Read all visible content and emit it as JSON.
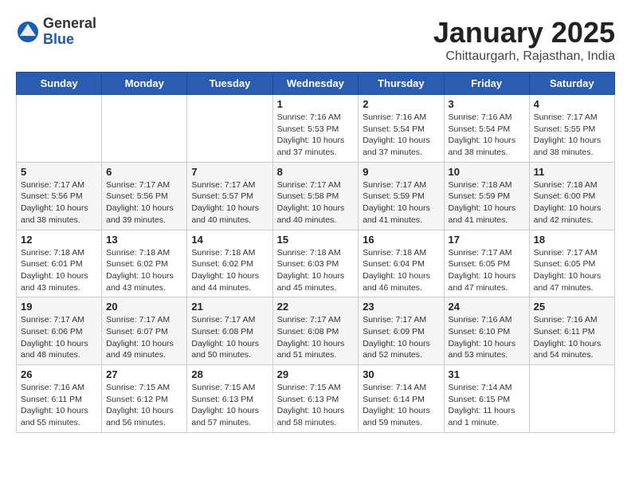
{
  "header": {
    "logo_general": "General",
    "logo_blue": "Blue",
    "month_title": "January 2025",
    "subtitle": "Chittaurgarh, Rajasthan, India"
  },
  "calendar": {
    "weekdays": [
      "Sunday",
      "Monday",
      "Tuesday",
      "Wednesday",
      "Thursday",
      "Friday",
      "Saturday"
    ],
    "weeks": [
      [
        {
          "day": "",
          "info": ""
        },
        {
          "day": "",
          "info": ""
        },
        {
          "day": "",
          "info": ""
        },
        {
          "day": "1",
          "info": "Sunrise: 7:16 AM\nSunset: 5:53 PM\nDaylight: 10 hours\nand 37 minutes."
        },
        {
          "day": "2",
          "info": "Sunrise: 7:16 AM\nSunset: 5:54 PM\nDaylight: 10 hours\nand 37 minutes."
        },
        {
          "day": "3",
          "info": "Sunrise: 7:16 AM\nSunset: 5:54 PM\nDaylight: 10 hours\nand 38 minutes."
        },
        {
          "day": "4",
          "info": "Sunrise: 7:17 AM\nSunset: 5:55 PM\nDaylight: 10 hours\nand 38 minutes."
        }
      ],
      [
        {
          "day": "5",
          "info": "Sunrise: 7:17 AM\nSunset: 5:56 PM\nDaylight: 10 hours\nand 38 minutes."
        },
        {
          "day": "6",
          "info": "Sunrise: 7:17 AM\nSunset: 5:56 PM\nDaylight: 10 hours\nand 39 minutes."
        },
        {
          "day": "7",
          "info": "Sunrise: 7:17 AM\nSunset: 5:57 PM\nDaylight: 10 hours\nand 40 minutes."
        },
        {
          "day": "8",
          "info": "Sunrise: 7:17 AM\nSunset: 5:58 PM\nDaylight: 10 hours\nand 40 minutes."
        },
        {
          "day": "9",
          "info": "Sunrise: 7:17 AM\nSunset: 5:59 PM\nDaylight: 10 hours\nand 41 minutes."
        },
        {
          "day": "10",
          "info": "Sunrise: 7:18 AM\nSunset: 5:59 PM\nDaylight: 10 hours\nand 41 minutes."
        },
        {
          "day": "11",
          "info": "Sunrise: 7:18 AM\nSunset: 6:00 PM\nDaylight: 10 hours\nand 42 minutes."
        }
      ],
      [
        {
          "day": "12",
          "info": "Sunrise: 7:18 AM\nSunset: 6:01 PM\nDaylight: 10 hours\nand 43 minutes."
        },
        {
          "day": "13",
          "info": "Sunrise: 7:18 AM\nSunset: 6:02 PM\nDaylight: 10 hours\nand 43 minutes."
        },
        {
          "day": "14",
          "info": "Sunrise: 7:18 AM\nSunset: 6:02 PM\nDaylight: 10 hours\nand 44 minutes."
        },
        {
          "day": "15",
          "info": "Sunrise: 7:18 AM\nSunset: 6:03 PM\nDaylight: 10 hours\nand 45 minutes."
        },
        {
          "day": "16",
          "info": "Sunrise: 7:18 AM\nSunset: 6:04 PM\nDaylight: 10 hours\nand 46 minutes."
        },
        {
          "day": "17",
          "info": "Sunrise: 7:17 AM\nSunset: 6:05 PM\nDaylight: 10 hours\nand 47 minutes."
        },
        {
          "day": "18",
          "info": "Sunrise: 7:17 AM\nSunset: 6:05 PM\nDaylight: 10 hours\nand 47 minutes."
        }
      ],
      [
        {
          "day": "19",
          "info": "Sunrise: 7:17 AM\nSunset: 6:06 PM\nDaylight: 10 hours\nand 48 minutes."
        },
        {
          "day": "20",
          "info": "Sunrise: 7:17 AM\nSunset: 6:07 PM\nDaylight: 10 hours\nand 49 minutes."
        },
        {
          "day": "21",
          "info": "Sunrise: 7:17 AM\nSunset: 6:08 PM\nDaylight: 10 hours\nand 50 minutes."
        },
        {
          "day": "22",
          "info": "Sunrise: 7:17 AM\nSunset: 6:08 PM\nDaylight: 10 hours\nand 51 minutes."
        },
        {
          "day": "23",
          "info": "Sunrise: 7:17 AM\nSunset: 6:09 PM\nDaylight: 10 hours\nand 52 minutes."
        },
        {
          "day": "24",
          "info": "Sunrise: 7:16 AM\nSunset: 6:10 PM\nDaylight: 10 hours\nand 53 minutes."
        },
        {
          "day": "25",
          "info": "Sunrise: 7:16 AM\nSunset: 6:11 PM\nDaylight: 10 hours\nand 54 minutes."
        }
      ],
      [
        {
          "day": "26",
          "info": "Sunrise: 7:16 AM\nSunset: 6:11 PM\nDaylight: 10 hours\nand 55 minutes."
        },
        {
          "day": "27",
          "info": "Sunrise: 7:15 AM\nSunset: 6:12 PM\nDaylight: 10 hours\nand 56 minutes."
        },
        {
          "day": "28",
          "info": "Sunrise: 7:15 AM\nSunset: 6:13 PM\nDaylight: 10 hours\nand 57 minutes."
        },
        {
          "day": "29",
          "info": "Sunrise: 7:15 AM\nSunset: 6:13 PM\nDaylight: 10 hours\nand 58 minutes."
        },
        {
          "day": "30",
          "info": "Sunrise: 7:14 AM\nSunset: 6:14 PM\nDaylight: 10 hours\nand 59 minutes."
        },
        {
          "day": "31",
          "info": "Sunrise: 7:14 AM\nSunset: 6:15 PM\nDaylight: 11 hours\nand 1 minute."
        },
        {
          "day": "",
          "info": ""
        }
      ]
    ]
  }
}
